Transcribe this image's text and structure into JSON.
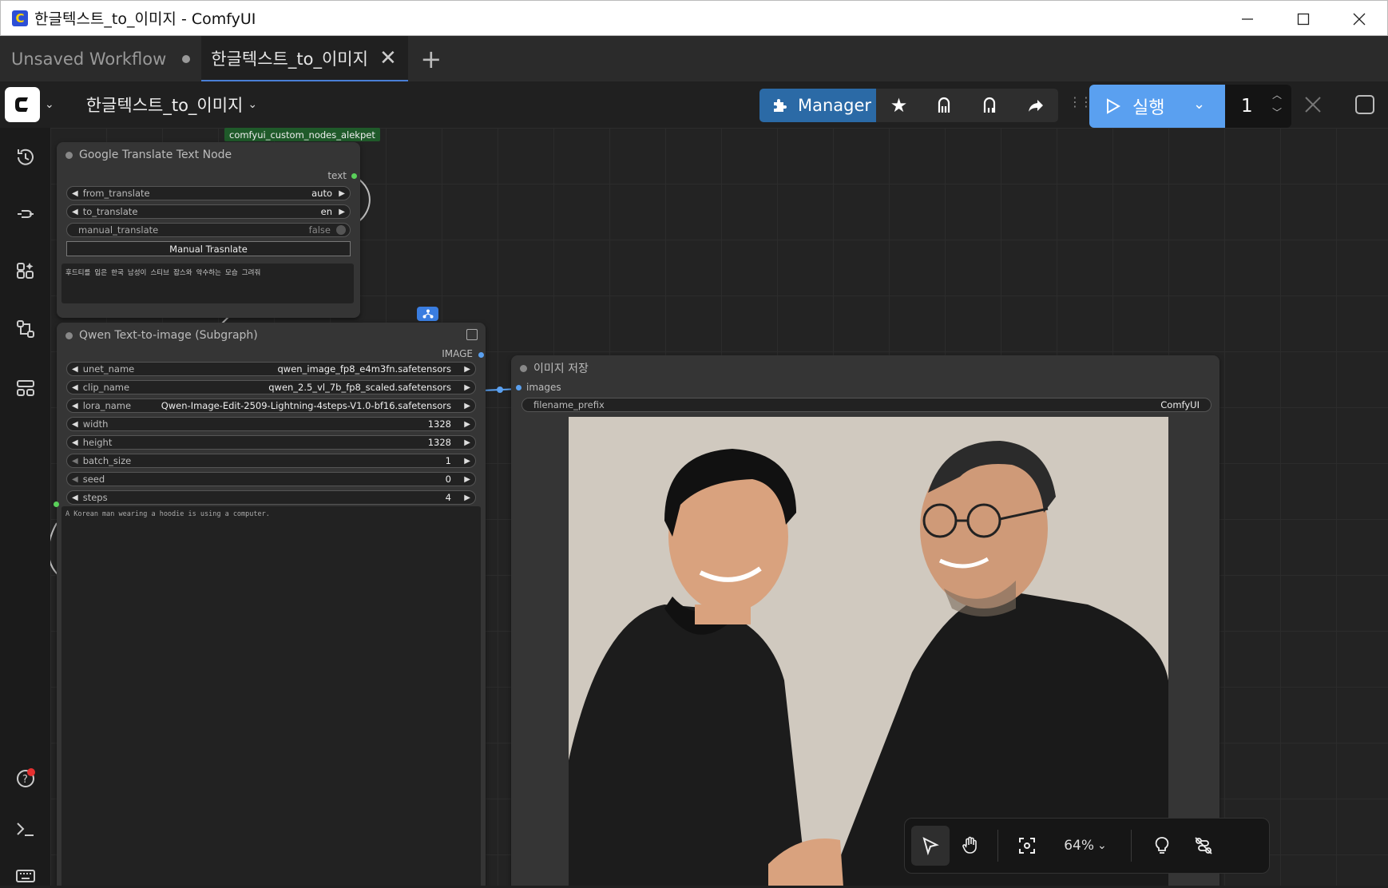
{
  "window": {
    "title": "한글텍스트_to_이미지 - ComfyUI",
    "app_icon_letter": "C"
  },
  "tabs": [
    {
      "label": "Unsaved Workflow",
      "modified": true
    },
    {
      "label": "한글텍스트_to_이미지",
      "active": true
    }
  ],
  "toolbar": {
    "workflow_name": "한글텍스트_to_이미지",
    "manager_label": "Manager",
    "run_label": "실행",
    "run_count": "1"
  },
  "canvas": {
    "group_label": "comfyui_custom_nodes_alekpet",
    "translate_node": {
      "title": "Google Translate Text Node",
      "output": "text",
      "widgets": [
        {
          "name": "from_translate",
          "value": "auto"
        },
        {
          "name": "to_translate",
          "value": "en"
        },
        {
          "name": "manual_translate",
          "value": "false"
        }
      ],
      "button": "Manual Trasnlate",
      "text": "후드티를 입은 한국 남성이 스티브 잡스와 악수하는 모습 그려줘"
    },
    "qwen_node": {
      "title": "Qwen Text-to-image (Subgraph)",
      "output": "IMAGE",
      "widgets": [
        {
          "name": "unet_name",
          "value": "qwen_image_fp8_e4m3fn.safetensors"
        },
        {
          "name": "clip_name",
          "value": "qwen_2.5_vl_7b_fp8_scaled.safetensors"
        },
        {
          "name": "lora_name",
          "value": "Qwen-Image-Edit-2509-Lightning-4steps-V1.0-bf16.safetensors"
        },
        {
          "name": "width",
          "value": "1328"
        },
        {
          "name": "height",
          "value": "1328"
        },
        {
          "name": "batch_size",
          "value": "1"
        },
        {
          "name": "seed",
          "value": "0"
        },
        {
          "name": "steps",
          "value": "4"
        }
      ],
      "text": "A Korean man wearing a hoodie is using a computer."
    },
    "save_node": {
      "title": "이미지 저장",
      "input": "images",
      "widget": {
        "name": "filename_prefix",
        "value": "ComfyUI"
      }
    }
  },
  "zoom": {
    "level": "64%"
  }
}
